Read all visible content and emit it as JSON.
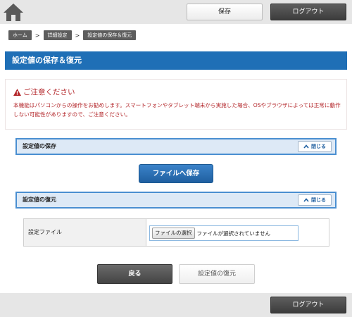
{
  "header": {
    "home_icon": "home-icon",
    "save_label": "保存",
    "logout_label": "ログアウト"
  },
  "breadcrumb": {
    "items": [
      "ホーム",
      "詳細設定",
      "設定値の保存＆復元"
    ],
    "separator": ">"
  },
  "page": {
    "title": "設定値の保存＆復元"
  },
  "notice": {
    "icon": "warning-icon",
    "title": "ご注意ください",
    "text": "本機能はパソコンからの操作をお勧めします。スマートフォンやタブレット端末から実施した場合、OSやブラウザによっては正常に動作しない可能性がありますので、ご注意ください。"
  },
  "save_section": {
    "title": "設定値の保存",
    "close_label": "閉じる",
    "save_to_file_label": "ファイルへ保存"
  },
  "restore_section": {
    "title": "設定値の復元",
    "close_label": "閉じる",
    "file_label": "設定ファイル",
    "choose_file_label": "ファイルの選択",
    "file_status": "ファイルが選択されていません"
  },
  "actions": {
    "back_label": "戻る",
    "restore_label": "設定値の復元"
  },
  "footer": {
    "logout_label": "ログアウト"
  },
  "colors": {
    "brand_blue": "#1f6fb6",
    "warning_red": "#b3262a",
    "section_bg": "#dde9f6"
  }
}
